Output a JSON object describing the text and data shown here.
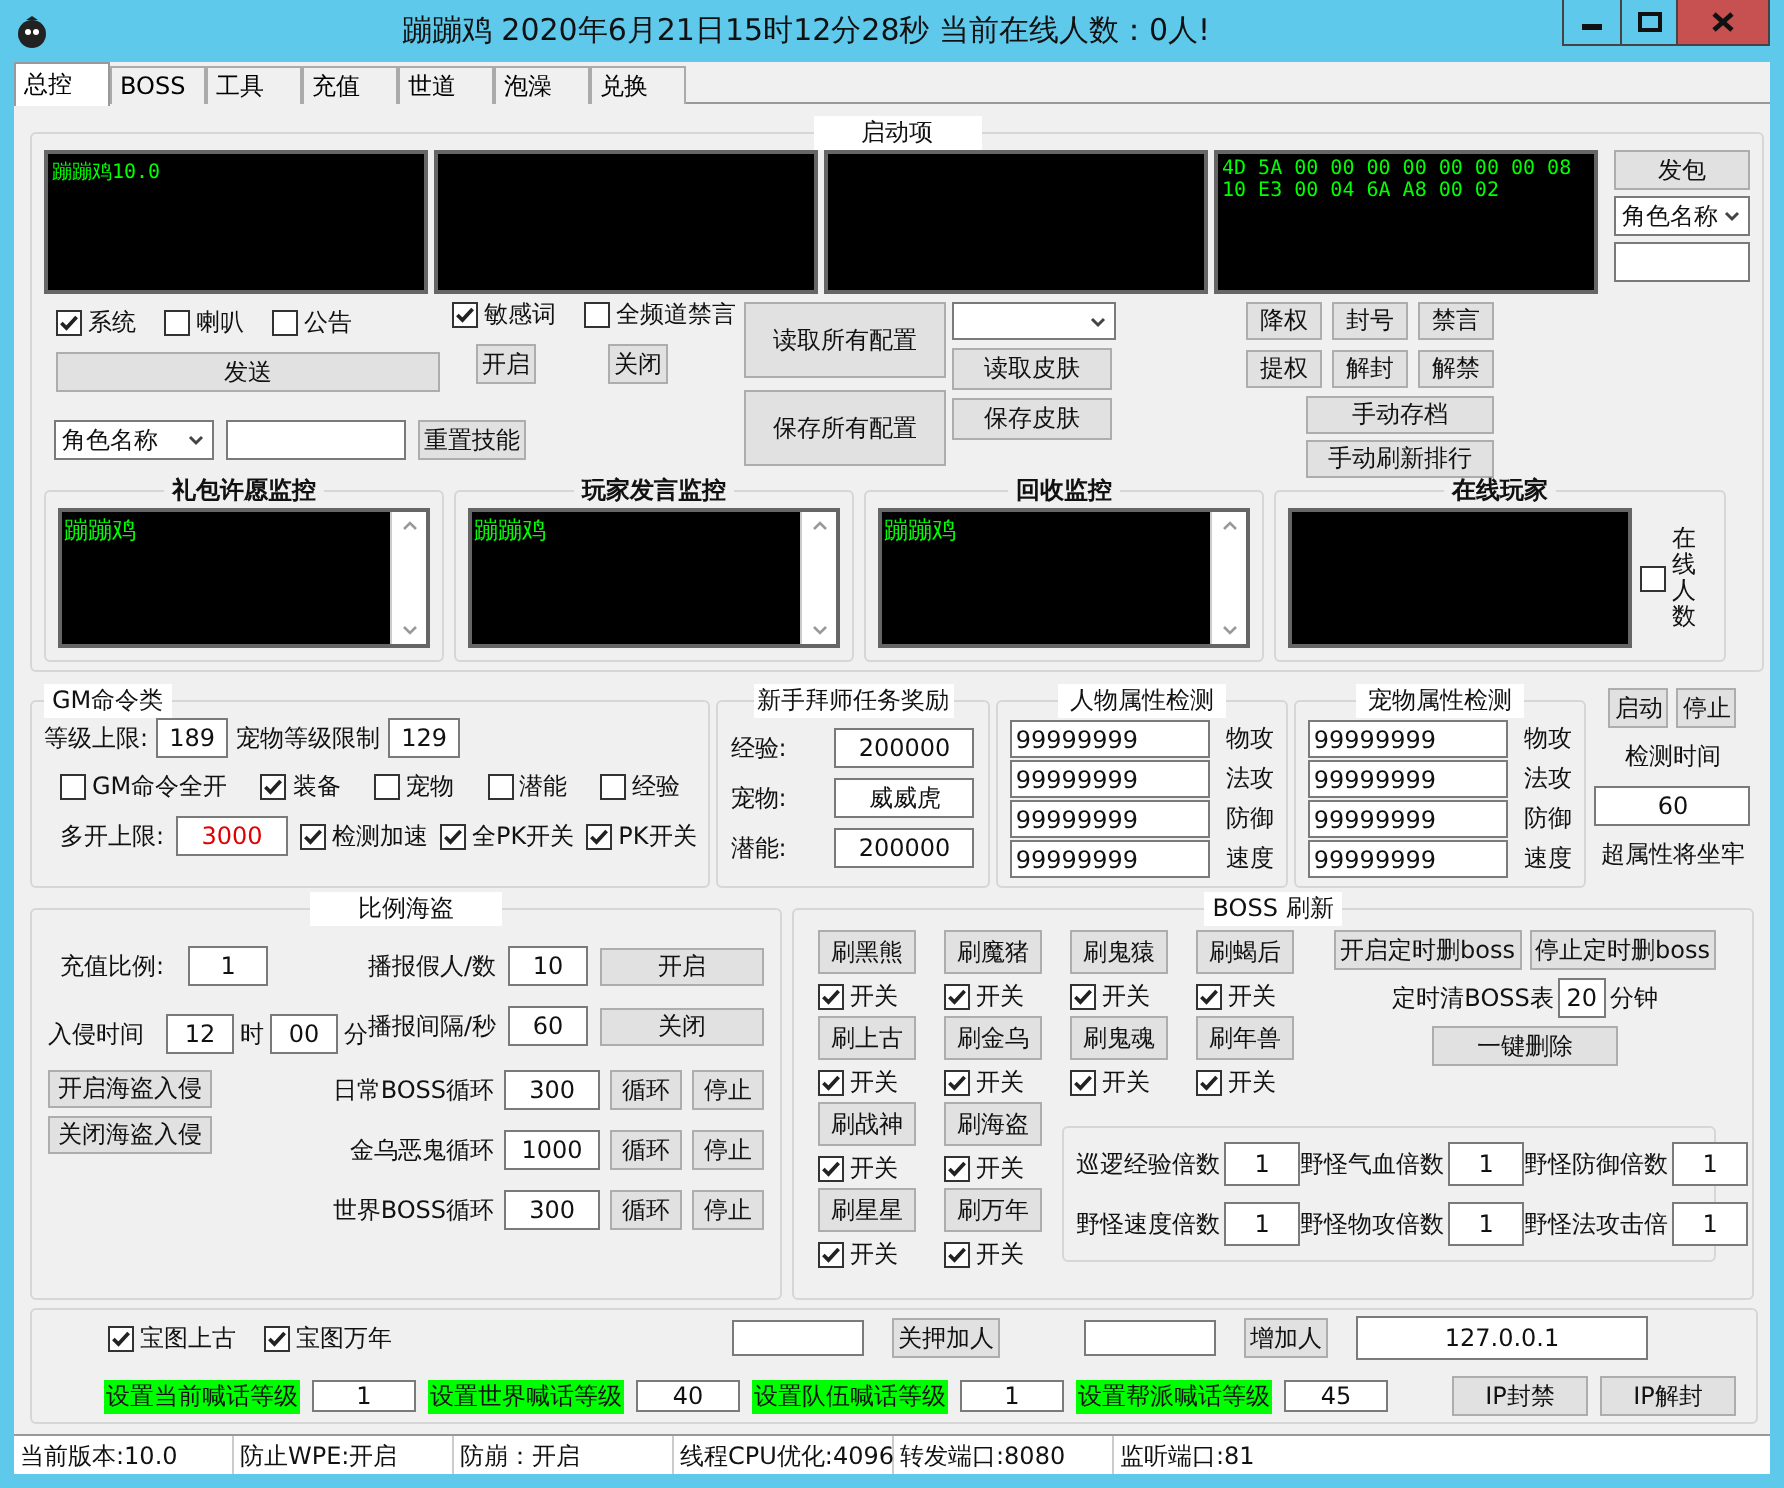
{
  "window": {
    "title": "蹦蹦鸡  2020年6月21日15时12分28秒  当前在线人数：0人!"
  },
  "tabs": [
    {
      "label": "总控",
      "selected": true
    },
    {
      "label": "BOSS",
      "selected": false
    },
    {
      "label": "工具",
      "selected": false
    },
    {
      "label": "充值",
      "selected": false
    },
    {
      "label": "世道",
      "selected": false
    },
    {
      "label": "泡澡",
      "selected": false
    },
    {
      "label": "兑换",
      "selected": false
    }
  ],
  "startup": {
    "title": "启动项",
    "log_console": {
      "text": "蹦蹦鸡10.0"
    },
    "hex_console": {
      "lines": [
        "4D 5A 00 00 00 00 00 00 00 08",
        "10 E3 00 04 6A A8 00 02"
      ]
    },
    "packet_button": "发包",
    "packet_role_select": "角色名称",
    "channels": [
      {
        "label": "系统",
        "checked": true
      },
      {
        "label": "喇叭",
        "checked": false
      },
      {
        "label": "公告",
        "checked": false
      }
    ],
    "send_button": "发送",
    "role_select": "角色名称",
    "reset_skill_button": "重置技能",
    "filters": [
      {
        "label": "敏感词",
        "checked": true
      },
      {
        "label": "全频道禁言",
        "checked": false
      }
    ],
    "filter_buttons": [
      "开启",
      "关闭"
    ],
    "config_buttons": [
      "读取所有配置",
      "保存所有配置"
    ],
    "skin_buttons": [
      "读取皮肤",
      "保存皮肤"
    ],
    "perm_buttons": [
      "降权",
      "封号",
      "禁言",
      "提权",
      "解封",
      "解禁"
    ],
    "save_buttons": [
      "手动存档",
      "手动刷新排行"
    ]
  },
  "monitors": [
    {
      "kind": "log",
      "title": "礼包许愿监控",
      "entries": [
        "蹦蹦鸡"
      ]
    },
    {
      "kind": "log",
      "title": "玩家发言监控",
      "entries": [
        "蹦蹦鸡"
      ]
    },
    {
      "kind": "log",
      "title": "回收监控",
      "entries": [
        "蹦蹦鸡"
      ]
    },
    {
      "kind": "players",
      "title": "在线玩家",
      "count_label": "在线人数",
      "checked": false
    }
  ],
  "gm": {
    "title": "GM命令类",
    "level_cap_label": "等级上限:",
    "level_cap": "189",
    "pet_cap_label": "宠物等级限制",
    "pet_cap": "129",
    "options": [
      {
        "label": "GM命令全开",
        "checked": false
      },
      {
        "label": "装备",
        "checked": true
      },
      {
        "label": "宠物",
        "checked": false
      },
      {
        "label": "潜能",
        "checked": false
      },
      {
        "label": "经验",
        "checked": false
      }
    ],
    "multi_label": "多开上限:",
    "multi_value": "3000",
    "toggles": [
      {
        "label": "检测加速",
        "checked": true
      },
      {
        "label": "全PK开关",
        "checked": true
      },
      {
        "label": "PK开关",
        "checked": true
      }
    ]
  },
  "mentor": {
    "title": "新手拜师任务奖励",
    "fields": [
      {
        "label": "经验:",
        "value": "200000"
      },
      {
        "label": "宠物:",
        "value": "威威虎"
      },
      {
        "label": "潜能:",
        "value": "200000"
      }
    ]
  },
  "checks": [
    {
      "title": "人物属性检测",
      "rows": [
        {
          "value": "99999999",
          "label": "物攻"
        },
        {
          "value": "99999999",
          "label": "法攻"
        },
        {
          "value": "99999999",
          "label": "防御"
        },
        {
          "value": "99999999",
          "label": "速度"
        }
      ]
    },
    {
      "title": "宠物属性检测",
      "rows": [
        {
          "value": "99999999",
          "label": "物攻"
        },
        {
          "value": "99999999",
          "label": "法攻"
        },
        {
          "value": "99999999",
          "label": "防御"
        },
        {
          "value": "99999999",
          "label": "速度"
        }
      ]
    }
  ],
  "detector": {
    "buttons": [
      "启动",
      "停止"
    ],
    "time_label": "检测时间",
    "time_value": "60",
    "note": "超属性将坐牢"
  },
  "pirate": {
    "title": "比例海盗",
    "ratio_label": "充值比例:",
    "ratio": "1",
    "time_label": "入侵时间",
    "hour": "12",
    "hour_unit": "时",
    "minute": "00",
    "minute_unit": "分",
    "buttons": [
      "开启海盗入侵",
      "关闭海盗入侵"
    ],
    "broadcast": [
      {
        "label": "播报假人/数",
        "value": "10",
        "button": "开启"
      },
      {
        "label": "播报间隔/秒",
        "value": "60",
        "button": "关闭"
      }
    ],
    "loops": [
      {
        "label": "日常BOSS循环",
        "value": "300",
        "buttons": [
          "循环",
          "停止"
        ]
      },
      {
        "label": "金乌恶鬼循环",
        "value": "1000",
        "buttons": [
          "循环",
          "停止"
        ]
      },
      {
        "label": "世界BOSS循环",
        "value": "300",
        "buttons": [
          "循环",
          "停止"
        ]
      }
    ]
  },
  "boss": {
    "title": "BOSS 刷新",
    "rows": [
      {
        "bosses": [
          {
            "button": "刷黑熊",
            "toggle": "开关",
            "checked": true
          },
          {
            "button": "刷魔猪",
            "toggle": "开关",
            "checked": true
          },
          {
            "button": "刷鬼猿",
            "toggle": "开关",
            "checked": true
          },
          {
            "button": "刷蝎后",
            "toggle": "开关",
            "checked": true
          }
        ]
      },
      {
        "bosses": [
          {
            "button": "刷上古",
            "toggle": "开关",
            "checked": true
          },
          {
            "button": "刷金乌",
            "toggle": "开关",
            "checked": true
          },
          {
            "button": "刷鬼魂",
            "toggle": "开关",
            "checked": true
          },
          {
            "button": "刷年兽",
            "toggle": "开关",
            "checked": true
          }
        ]
      },
      {
        "bosses": [
          {
            "button": "刷战神",
            "toggle": "开关",
            "checked": true
          },
          {
            "button": "刷海盗",
            "toggle": "开关",
            "checked": true
          }
        ]
      },
      {
        "bosses": [
          {
            "button": "刷星星",
            "toggle": "开关",
            "checked": true
          },
          {
            "button": "刷万年",
            "toggle": "开关",
            "checked": true
          }
        ]
      }
    ],
    "timer_buttons": [
      "开启定时删boss",
      "停止定时删boss"
    ],
    "clear_label": "定时清BOSS表",
    "clear_value": "20",
    "clear_unit": "分钟",
    "delete_all": "一键删除",
    "multipliers": [
      {
        "label": "巡逻经验倍数",
        "value": "1"
      },
      {
        "label": "野怪气血倍数",
        "value": "1"
      },
      {
        "label": "野怪防御倍数",
        "value": "1"
      },
      {
        "label": "野怪速度倍数",
        "value": "1"
      },
      {
        "label": "野怪物攻倍数",
        "value": "1"
      },
      {
        "label": "野怪法攻击倍",
        "value": "1"
      }
    ]
  },
  "bottom": {
    "maps": [
      {
        "label": "宝图上古",
        "checked": true
      },
      {
        "label": "宝图万年",
        "checked": true
      }
    ],
    "add_buttons": [
      "关押加人",
      "增加人"
    ],
    "ip": "127.0.0.1",
    "levels": [
      {
        "label": "设置当前喊话等级",
        "value": "1"
      },
      {
        "label": "设置世界喊话等级",
        "value": "40"
      },
      {
        "label": "设置队伍喊话等级",
        "value": "1"
      },
      {
        "label": "设置帮派喊话等级",
        "value": "45"
      }
    ],
    "ip_buttons": [
      "IP封禁",
      "IP解封"
    ]
  },
  "status_bar": [
    "当前版本:10.0",
    "防止WPE:开启",
    "防崩：开启",
    "线程CPU优化:4096",
    "转发端口:8080",
    "监听端口:81"
  ]
}
